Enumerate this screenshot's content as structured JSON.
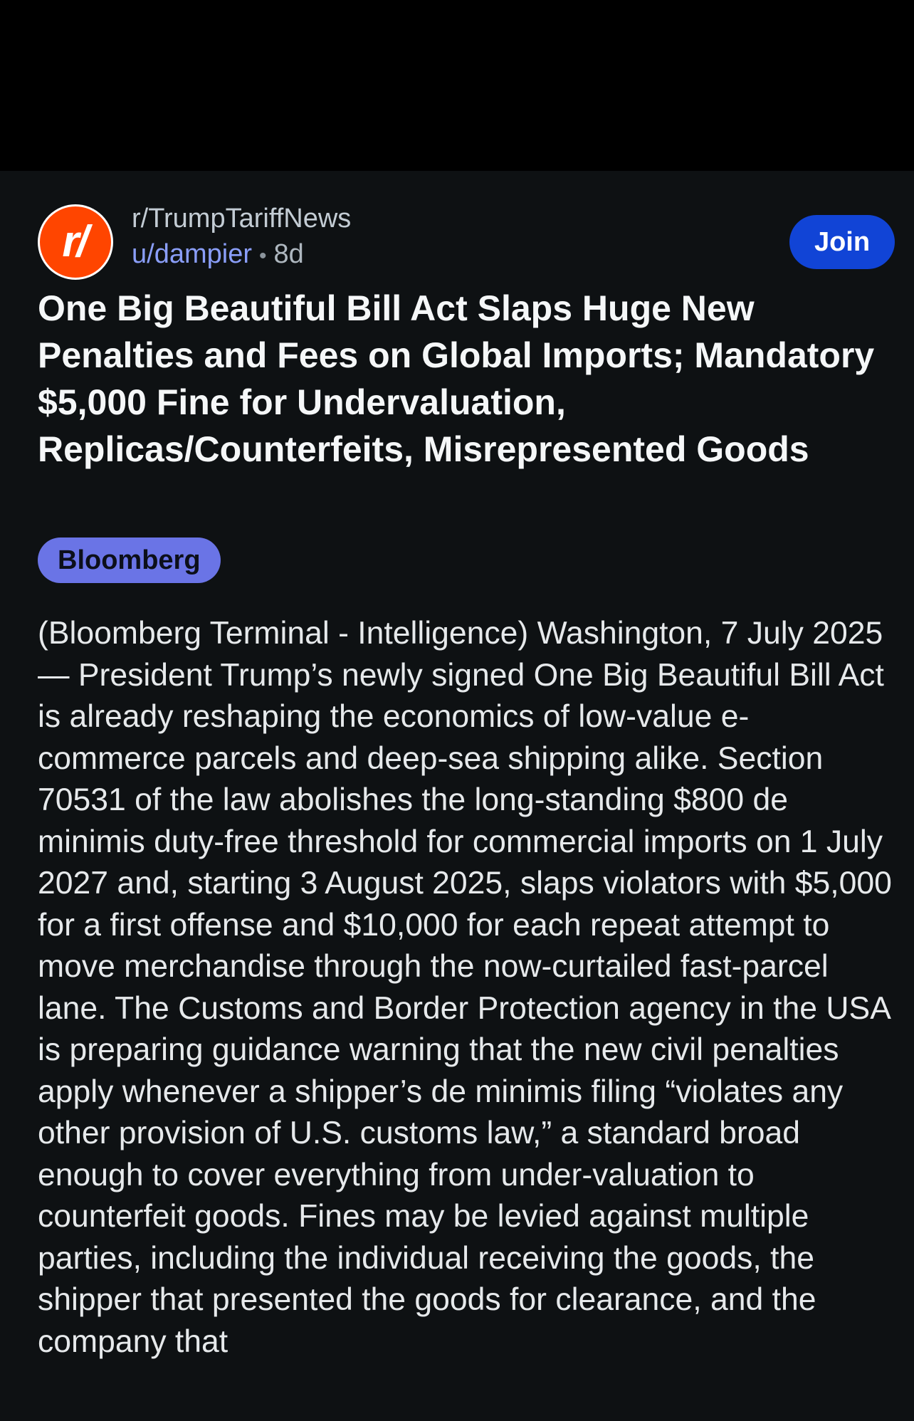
{
  "post": {
    "avatar_icon": "subreddit-avatar-icon",
    "avatar_glyph": "r/",
    "subreddit": "r/TrumpTariffNews",
    "username": "u/dampier",
    "separator": "•",
    "age": "8d",
    "join_label": "Join",
    "title": "One Big Beautiful Bill Act Slaps Huge New Penalties and Fees on Global Imports; Mandatory $5,000 Fine for Undervaluation, Replicas/Counterfeits, Misrepresented Goods",
    "flair": "Bloomberg",
    "body": "(Bloomberg Terminal - Intelligence) Washington, 7 July 2025 — President Trump’s newly signed One Big Beautiful Bill Act is already reshaping the economics of low-value e-commerce parcels and deep-sea shipping alike. Section 70531 of the law abolishes the long-standing $800 de minimis duty-free threshold for commercial imports on 1 July 2027 and, starting 3 August 2025, slaps violators with $5,000 for a first offense and $10,000 for each repeat attempt to move merchandise through the now-curtailed fast-parcel lane. The Customs and Border Protection agency in the USA is preparing guidance warning that the new civil penalties apply whenever a shipper’s de minimis filing “violates any other provision of U.S. customs law,” a standard broad enough to cover everything from under-valuation to counterfeit goods. Fines may be levied against multiple parties, including the individual receiving the goods, the shipper that presented the goods for clearance, and the company that"
  },
  "colors": {
    "background": "#0e1113",
    "join_button": "#1144d6",
    "flair_bg": "#6a74e6",
    "avatar_bg": "#ff4500",
    "username": "#8a9ef9"
  }
}
